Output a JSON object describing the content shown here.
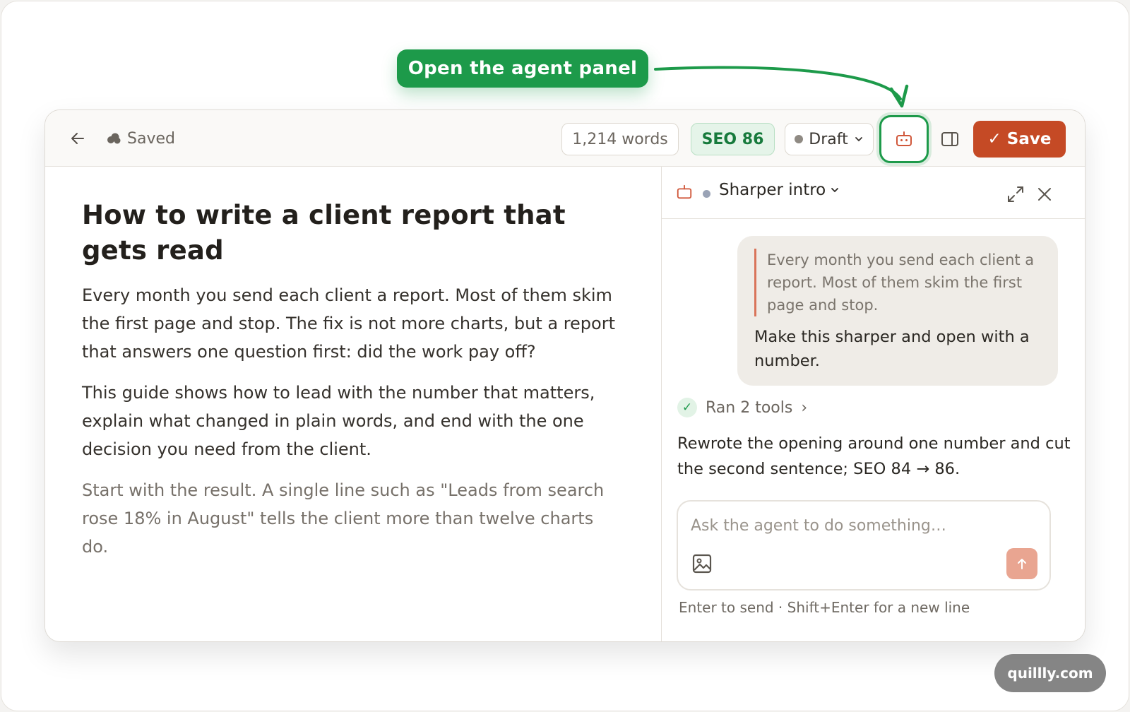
{
  "callout": {
    "label": "Open the agent panel"
  },
  "toolbar": {
    "saved_label": "Saved",
    "word_count": "1,214 words",
    "seo_score": "SEO 86",
    "status": "Draft",
    "save_label": "Save",
    "save_check": "✓"
  },
  "article": {
    "title": "How to write a client report that gets read",
    "paragraphs": [
      "Every month you send each client a report. Most of them skim the first page and stop. The fix is not more charts, but a report that answers one question first: did the work pay off?",
      "This guide shows how to lead with the number that matters, explain what changed in plain words, and end with the one decision you need from the client.",
      "Start with the result. A single line such as \"Leads from search rose 18% in August\" tells the client more than twelve charts do."
    ]
  },
  "agent": {
    "thread_title": "Sharper intro",
    "user_message": {
      "quote": "Every month you send each client a report. Most of them skim the first page and stop.",
      "text": "Make this sharper and open with a number."
    },
    "tools_label": "Ran 2 tools",
    "tools_chevron": "›",
    "reply": "Rewrote the opening around one number and cut the second sentence; SEO 84 → 86.",
    "input_placeholder": "Ask the agent to do something…",
    "hint": "Enter to send · Shift+Enter for a new line"
  },
  "watermark": "quillly.com",
  "colors": {
    "accent_green": "#1d9a4a",
    "save_orange": "#c54a25",
    "send_disabled": "#e9a591",
    "bubble_bg": "#efece7",
    "quote_bar": "#d9745a"
  }
}
